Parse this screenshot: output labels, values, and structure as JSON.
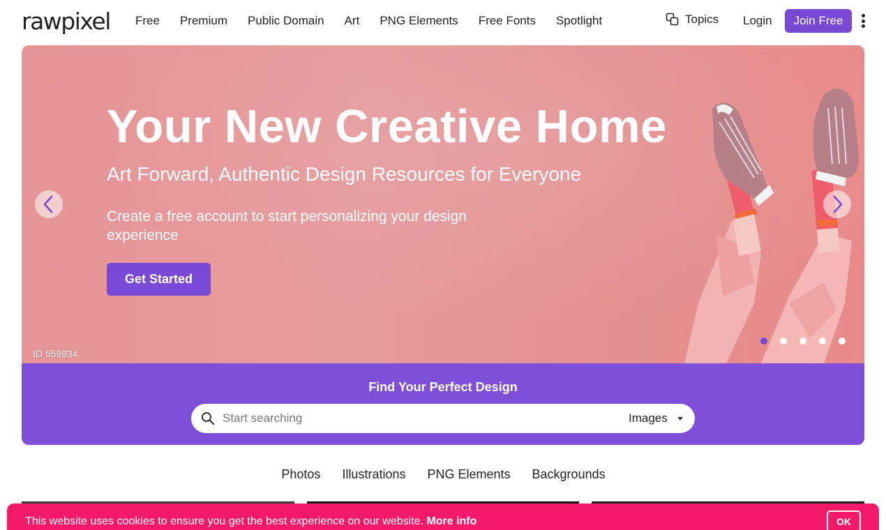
{
  "header": {
    "logo": "rawpixel",
    "nav": [
      "Free",
      "Premium",
      "Public Domain",
      "Art",
      "PNG Elements",
      "Free Fonts",
      "Spotlight"
    ],
    "topics_label": "Topics",
    "login_label": "Login",
    "join_label": "Join Free"
  },
  "hero": {
    "title": "Your New Creative Home",
    "subtitle": "Art Forward, Authentic Design Resources for Everyone",
    "description": "Create a free account to start personalizing your design experience",
    "cta_label": "Get Started",
    "image_id": "ID 559934",
    "slide_count": 5,
    "active_slide": 1
  },
  "search": {
    "title": "Find Your Perfect Design",
    "placeholder": "Start searching",
    "type_selected": "Images"
  },
  "category_tabs": [
    "Photos",
    "Illustrations",
    "PNG Elements",
    "Backgrounds"
  ],
  "cookie": {
    "message": "This website uses cookies to ensure you get the best experience on our website.",
    "link_label": "More info",
    "ok_label": "OK"
  },
  "colors": {
    "brand_purple": "#7a48d6",
    "search_band": "#7f4fd9",
    "hero_bg": "#e59a9c",
    "cookie_bg": "#f5196a"
  }
}
